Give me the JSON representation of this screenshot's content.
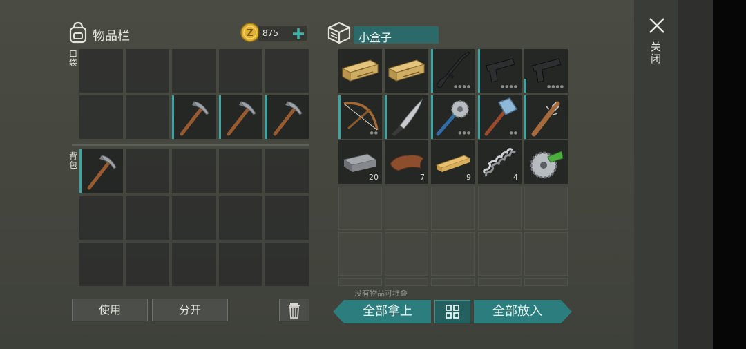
{
  "inventory": {
    "title": "物品栏",
    "coins": "875",
    "pocket_label": "口袋",
    "backpack_label": "背包",
    "use_label": "使用",
    "split_label": "分开"
  },
  "container": {
    "title": "小盒子",
    "no_stack_hint": "没有物品可堆叠",
    "take_all_label": "全部拿上",
    "put_all_label": "全部放入",
    "items": [
      {
        "icon": "ammo-box-icon"
      },
      {
        "icon": "ammo-box-icon"
      },
      {
        "icon": "assault-rifle-icon"
      },
      {
        "icon": "pistol-icon"
      },
      {
        "icon": "pistol-icon"
      },
      {
        "icon": "crossbow-icon"
      },
      {
        "icon": "machete-icon"
      },
      {
        "icon": "saw-mace-icon"
      },
      {
        "icon": "sledgehammer-icon"
      },
      {
        "icon": "nail-bat-icon"
      },
      {
        "icon": "iron-bar-icon",
        "count": "20"
      },
      {
        "icon": "leather-icon",
        "count": "7"
      },
      {
        "icon": "wood-plank-icon",
        "count": "9"
      },
      {
        "icon": "spring-icon",
        "count": "4"
      },
      {
        "icon": "saw-blade-icon"
      }
    ]
  },
  "close_label": "关闭",
  "colors": {
    "accent": "#2c7d7d",
    "durability": "#3aa6a6",
    "gold": "#e0b030"
  }
}
